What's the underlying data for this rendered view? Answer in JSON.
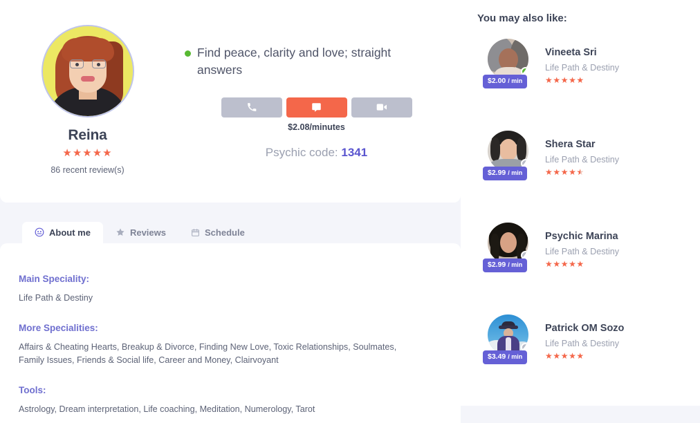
{
  "profile": {
    "name": "Reina",
    "rating": 5,
    "review_count_text": "86 recent review(s)",
    "tagline": "Find peace, clarity and love; straight answers",
    "online": true,
    "price_text": "$2.08/minutes",
    "psychic_code_label": "Psychic code:",
    "psychic_code_value": "1341",
    "actions": [
      {
        "name": "call",
        "icon": "phone-icon",
        "style": "secondary"
      },
      {
        "name": "chat",
        "icon": "chat-bubble-icon",
        "style": "primary"
      },
      {
        "name": "video",
        "icon": "video-camera-icon",
        "style": "secondary"
      }
    ]
  },
  "tabs": [
    {
      "id": "about",
      "label": "About me",
      "icon": "user-circle-icon",
      "active": true
    },
    {
      "id": "reviews",
      "label": "Reviews",
      "icon": "star-icon",
      "active": false
    },
    {
      "id": "schedule",
      "label": "Schedule",
      "icon": "calendar-icon",
      "active": false
    }
  ],
  "about": {
    "main_speciality_heading": "Main Speciality:",
    "main_speciality_body": "Life Path & Destiny",
    "more_specialities_heading": "More Specialities:",
    "more_specialities_body": "Affairs & Cheating Hearts, Breakup & Divorce, Finding New Love, Toxic Relationships, Soulmates, Family Issues, Friends & Social life, Career and Money, Clairvoyant",
    "tools_heading": "Tools:",
    "tools_body": "Astrology, Dream interpretation, Life coaching, Meditation, Numerology, Tarot"
  },
  "sidebar": {
    "title": "You may also like:",
    "items": [
      {
        "name": "Vineeta Sri",
        "speciality": "Life Path & Destiny",
        "price": "$2.00",
        "price_unit": "/ min",
        "rating": 5,
        "status": "online"
      },
      {
        "name": "Shera Star",
        "speciality": "Life Path & Destiny",
        "price": "$2.99",
        "price_unit": "/ min",
        "rating": 4.5,
        "status": "offline"
      },
      {
        "name": "Psychic Marina",
        "speciality": "Life Path & Destiny",
        "price": "$2.99",
        "price_unit": "/ min",
        "rating": 5,
        "status": "offline"
      },
      {
        "name": "Patrick OM Sozo",
        "speciality": "Life Path & Destiny",
        "price": "$3.49",
        "price_unit": "/ min",
        "rating": 5,
        "status": "offline"
      }
    ]
  },
  "colors": {
    "accent_orange": "#f4674a",
    "accent_purple": "#6560d6",
    "heading_purple": "#6f6fcf",
    "online_green": "#58b932",
    "offline_gray": "#b9bcc8",
    "page_bg": "#f4f5fa",
    "card_bg": "#ffffff",
    "text_dark": "#3d4457",
    "text_muted": "#9ba0b0"
  }
}
